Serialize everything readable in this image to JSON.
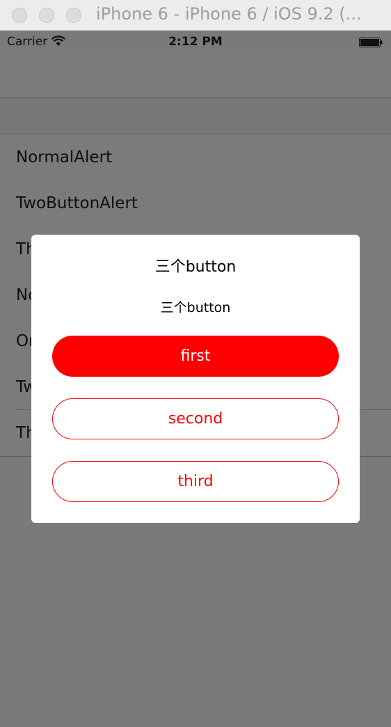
{
  "window": {
    "title": "iPhone 6 - iPhone 6 / iOS 9.2 (..."
  },
  "statusbar": {
    "carrier": "Carrier",
    "time": "2:12 PM"
  },
  "list": {
    "items": [
      {
        "label": "NormalAlert"
      },
      {
        "label": "TwoButtonAlert"
      },
      {
        "label": "Th"
      },
      {
        "label": "No"
      },
      {
        "label": "On"
      },
      {
        "label": "Tw"
      },
      {
        "label": "Th"
      }
    ]
  },
  "alert": {
    "title": "三个button",
    "message": "三个button",
    "buttons": {
      "first": "first",
      "second": "second",
      "third": "third"
    }
  },
  "colors": {
    "accent": "#ff0000",
    "dim_background": "#7a7a7b"
  }
}
